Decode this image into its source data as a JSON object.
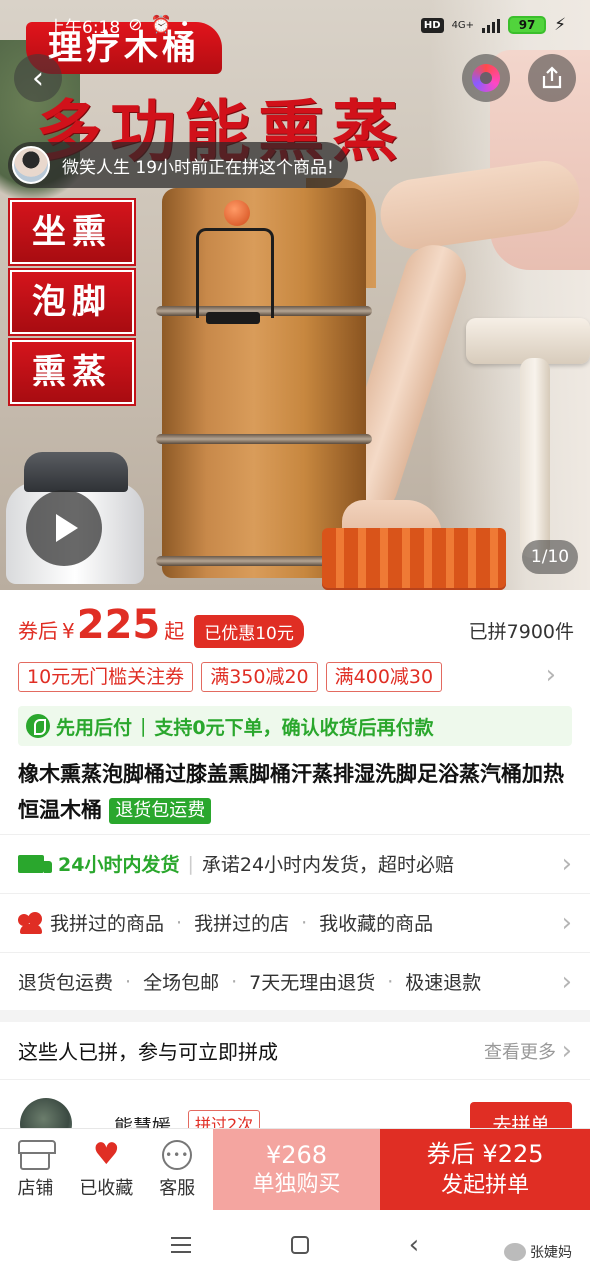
{
  "status_bar": {
    "time": "上午6:18",
    "network": "4G+",
    "battery": "97"
  },
  "hero": {
    "banner_title": "理疗木桶",
    "headline": "多功能熏蒸",
    "features": [
      "坐熏",
      "泡脚",
      "熏蒸"
    ],
    "social_proof": "微笑人生 19小时前正在拼这个商品!",
    "page_counter": "1/10"
  },
  "price": {
    "prefix": "券后",
    "currency": "¥",
    "value": "225",
    "suffix": "起",
    "discount_tag": "已优惠10元",
    "sold_count": "已拼7900件"
  },
  "coupons": [
    "10元无门槛关注券",
    "满350减20",
    "满400减30"
  ],
  "paylater": {
    "label": "先用后付",
    "detail": "支持0元下单，确认收货后再付款"
  },
  "product": {
    "title": "橡木熏蒸泡脚桶过膝盖熏脚桶汗蒸排湿洗脚足浴蒸汽桶加热恒温木桶",
    "tag": "退货包运费"
  },
  "shipping": {
    "label": "24小时内发货",
    "detail": "承诺24小时内发货，超时必赔"
  },
  "history_links": [
    "我拼过的商品",
    "我拼过的店",
    "我收藏的商品"
  ],
  "guarantees": [
    "退货包运费",
    "全场包邮",
    "7天无理由退货",
    "极速退款"
  ],
  "group": {
    "header": "这些人已拼，参与可立即拼成",
    "more": "查看更多",
    "member_name": "熊慧媛",
    "member_badge": "拼过2次",
    "join_label": "去拼单"
  },
  "action_bar": {
    "store": "店铺",
    "favorite": "已收藏",
    "service": "客服",
    "alone_price": "¥268",
    "alone_label": "单独购买",
    "group_price": "券后 ¥225",
    "group_label": "发起拼单"
  },
  "watermark": "张婕妈",
  "colors": {
    "accent": "#e02e24",
    "green": "#2aa72d",
    "alone_bg": "#f4a5a0"
  }
}
